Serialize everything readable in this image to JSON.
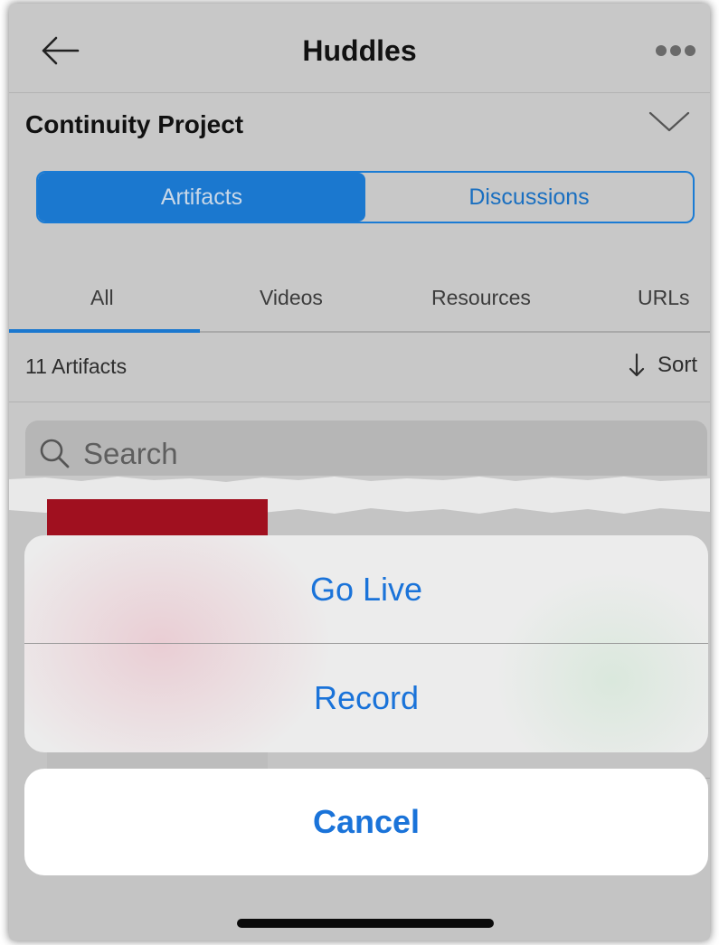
{
  "header": {
    "title": "Huddles",
    "back_icon": "arrow-left-icon",
    "more_icon": "ellipsis-icon"
  },
  "project": {
    "title": "Continuity Project",
    "expand_icon": "chevron-down-icon"
  },
  "segment": {
    "items": [
      {
        "label": "Artifacts",
        "active": true
      },
      {
        "label": "Discussions",
        "active": false
      }
    ]
  },
  "tabs": {
    "items": [
      {
        "label": "All",
        "active": true
      },
      {
        "label": "Videos",
        "active": false
      },
      {
        "label": "Resources",
        "active": false
      },
      {
        "label": "URLs",
        "active": false
      }
    ]
  },
  "list_info": {
    "count": "11 Artifacts",
    "sort_label": "Sort",
    "sort_icon": "arrow-down-icon"
  },
  "search": {
    "placeholder": "Search",
    "value": ""
  },
  "action_sheet": {
    "go_live": "Go Live",
    "record": "Record",
    "cancel": "Cancel"
  },
  "colors": {
    "accent": "#1a73d9",
    "segment_active": "#1b78cf",
    "dimmed_background": "#c8c8c8",
    "thumbnail_red": "#a0101f"
  }
}
